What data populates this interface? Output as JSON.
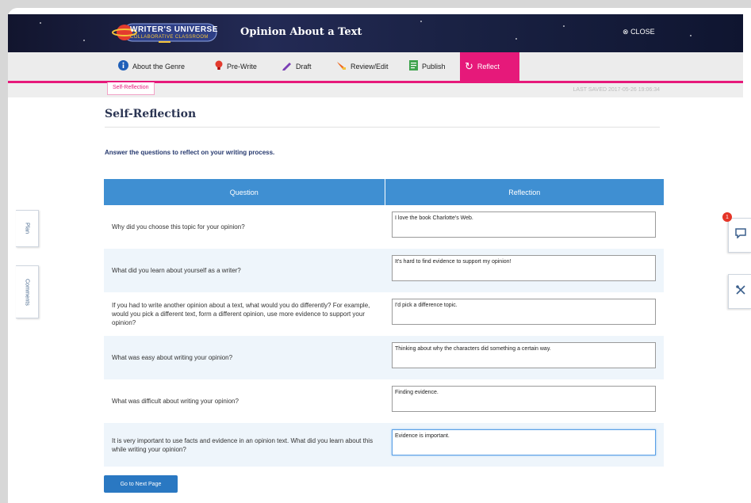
{
  "app": {
    "logo_title": "WRITER'S UNIVERSE",
    "logo_subtitle": "COLLABORATIVE CLASSROOM",
    "title": "Opinion About a Text",
    "close_label": "CLOSE"
  },
  "nav": {
    "tabs": [
      {
        "label": "About the Genre",
        "icon": "info-icon"
      },
      {
        "label": "Pre-Write",
        "icon": "lightbulb-icon"
      },
      {
        "label": "Draft",
        "icon": "pencil-icon"
      },
      {
        "label": "Review/Edit",
        "icon": "highlighter-icon"
      },
      {
        "label": "Publish",
        "icon": "document-icon"
      },
      {
        "label": "Reflect",
        "icon": "refresh-icon",
        "active": true
      }
    ]
  },
  "subnav": {
    "breadcrumb": "Self-Reflection",
    "last_saved": "LAST SAVED 2017-05-26 19:06:34"
  },
  "content": {
    "page_title": "Self-Reflection",
    "instructions": "Answer the questions to reflect on your writing process.",
    "table": {
      "headers": [
        "Question",
        "Reflection"
      ],
      "rows": [
        {
          "question": "Why did you choose this topic for your opinion?",
          "reflection": "I love the book Charlotte's Web."
        },
        {
          "question": "What did you learn about yourself as a writer?",
          "reflection": "It's hard to find evidence to support my opinion!"
        },
        {
          "question": "If you had to write another opinion about a text, what would you do differently? For example, would you pick a different text, form a different opinion, use more evidence to support your opinion?",
          "reflection": "I'd pick a difference topic."
        },
        {
          "question": "What was easy about writing your opinion?",
          "reflection": "Thinking about why the characters did something a certain way."
        },
        {
          "question": "What was difficult about writing your opinion?",
          "reflection": "Finding evidence."
        },
        {
          "question": "It is very important to use facts and evidence in an opinion text. What did you learn about this while writing your opinion?",
          "reflection": "Evidence is important."
        }
      ]
    },
    "next_button": "Go to Next Page"
  },
  "side_tabs": {
    "plan": "Plan",
    "comments": "Comments"
  },
  "right_tools": {
    "chat_badge": "1",
    "chat_icon": "chat-icon",
    "tools_icon": "tools-icon"
  },
  "colors": {
    "accent_pink": "#e6197a",
    "table_header_blue": "#3f8fd2",
    "button_blue": "#2a78c2",
    "header_navy": "#1a2244"
  }
}
